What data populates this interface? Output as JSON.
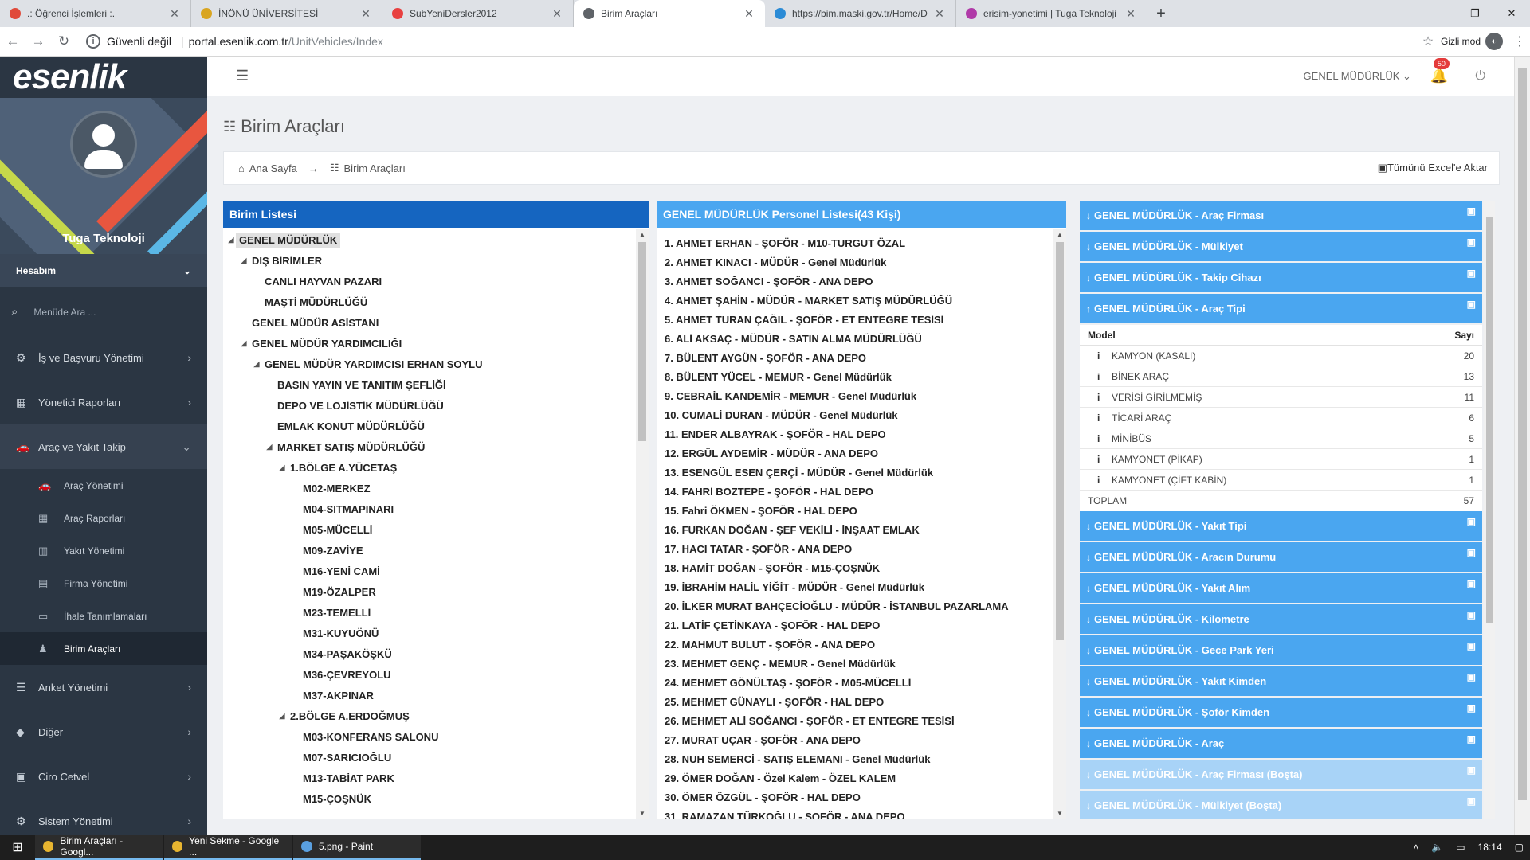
{
  "browser": {
    "tabs": [
      {
        "title": ".: Öğrenci İşlemleri :.",
        "color": "#e04a3a",
        "active": false
      },
      {
        "title": "İNÖNÜ ÜNİVERSİTESİ",
        "color": "#d9a520",
        "active": false
      },
      {
        "title": "SubYeniDersler2012",
        "color": "#e84040",
        "active": false
      },
      {
        "title": "Birim Araçları",
        "color": "#5f6368",
        "active": true
      },
      {
        "title": "https://bim.maski.gov.tr/Home/D",
        "color": "#2b8bd6",
        "active": false
      },
      {
        "title": "erisim-yonetimi | Tuga Teknoloji",
        "color": "#b03aa8",
        "active": false
      }
    ],
    "new_tab": "+",
    "window_controls": [
      "—",
      "❐",
      "✕"
    ],
    "security": "Güvenli değil",
    "url_host": "portal.esenlik.com.tr",
    "url_path": "/UnitVehicles/Index",
    "incognito": "Gizli mod"
  },
  "sidebar": {
    "logo": "esenlik",
    "user": "Tuga Teknoloji",
    "account": "Hesabım",
    "search_placeholder": "Menüde Ara ...",
    "menu": [
      {
        "label": "İş ve Başvuru Yönetimi",
        "icon": "gears-icon",
        "glyph": "⚙"
      },
      {
        "label": "Yönetici Raporları",
        "icon": "chart-icon",
        "glyph": "▦"
      },
      {
        "label": "Araç ve Yakıt Takip",
        "icon": "car-icon",
        "glyph": "🚗",
        "open": true
      }
    ],
    "submenu": [
      {
        "label": "Araç Yönetimi",
        "icon": "car-icon",
        "glyph": "🚗"
      },
      {
        "label": "Araç Raporları",
        "icon": "chart-icon",
        "glyph": "▦"
      },
      {
        "label": "Yakıt Yönetimi",
        "icon": "building-icon",
        "glyph": "▥"
      },
      {
        "label": "Firma Yönetimi",
        "icon": "document-icon",
        "glyph": "▤"
      },
      {
        "label": "İhale Tanımlamaları",
        "icon": "card-icon",
        "glyph": "▭"
      },
      {
        "label": "Birim Araçları",
        "icon": "sitemap-icon",
        "glyph": "♟",
        "active": true
      }
    ],
    "menu_after": [
      {
        "label": "Anket Yönetimi",
        "icon": "list-icon",
        "glyph": "☰"
      },
      {
        "label": "Diğer",
        "icon": "tag-icon",
        "glyph": "◆"
      },
      {
        "label": "Ciro Cetvel",
        "icon": "shop-icon",
        "glyph": "▣"
      },
      {
        "label": "Sistem Yönetimi",
        "icon": "gears-icon",
        "glyph": "⚙"
      }
    ]
  },
  "topbar": {
    "unit": "GENEL MÜDÜRLÜK",
    "notifications": "50"
  },
  "page": {
    "title": "Birim Araçları",
    "breadcrumb_home": "Ana Sayfa",
    "breadcrumb_current": "Birim Araçları",
    "excel_export": "Tümünü Excel'e Aktar"
  },
  "unit_list": {
    "header": "Birim Listesi",
    "header_color": "#1565c0",
    "nodes": [
      {
        "label": "GENEL MÜDÜRLÜK",
        "level": 0,
        "toggle": true,
        "selected": true
      },
      {
        "label": "DIŞ BİRİMLER",
        "level": 1,
        "toggle": true
      },
      {
        "label": "CANLI HAYVAN PAZARI",
        "level": 2
      },
      {
        "label": "MAŞTİ MÜDÜRLÜĞÜ",
        "level": 2
      },
      {
        "label": "GENEL MÜDÜR ASİSTANI",
        "level": 1
      },
      {
        "label": "GENEL MÜDÜR YARDIMCILIĞI",
        "level": 1,
        "toggle": true
      },
      {
        "label": "GENEL MÜDÜR YARDIMCISI ERHAN SOYLU",
        "level": 2,
        "toggle": true
      },
      {
        "label": "BASIN YAYIN VE TANITIM ŞEFLİĞİ",
        "level": 3
      },
      {
        "label": "DEPO VE LOJİSTİK MÜDÜRLÜĞÜ",
        "level": 3
      },
      {
        "label": "EMLAK KONUT MÜDÜRLÜĞÜ",
        "level": 3
      },
      {
        "label": "MARKET SATIŞ MÜDÜRLÜĞÜ",
        "level": 3,
        "toggle": true
      },
      {
        "label": "1.BÖLGE A.YÜCETAŞ",
        "level": 4,
        "toggle": true
      },
      {
        "label": "M02-MERKEZ",
        "level": 5
      },
      {
        "label": "M04-SITMAPINARI",
        "level": 5
      },
      {
        "label": "M05-MÜCELLİ",
        "level": 5
      },
      {
        "label": "M09-ZAVİYE",
        "level": 5
      },
      {
        "label": "M16-YENİ CAMİ",
        "level": 5
      },
      {
        "label": "M19-ÖZALPER",
        "level": 5
      },
      {
        "label": "M23-TEMELLİ",
        "level": 5
      },
      {
        "label": "M31-KUYUÖNÜ",
        "level": 5
      },
      {
        "label": "M34-PAŞAKÖŞKÜ",
        "level": 5
      },
      {
        "label": "M36-ÇEVREYOLU",
        "level": 5
      },
      {
        "label": "M37-AKPINAR",
        "level": 5
      },
      {
        "label": "2.BÖLGE A.ERDOĞMUŞ",
        "level": 4,
        "toggle": true
      },
      {
        "label": "M03-KONFERANS SALONU",
        "level": 5
      },
      {
        "label": "M07-SARICIOĞLU",
        "level": 5
      },
      {
        "label": "M13-TABİAT PARK",
        "level": 5
      },
      {
        "label": "M15-ÇOŞNÜK",
        "level": 5
      }
    ]
  },
  "personnel": {
    "header": "GENEL MÜDÜRLÜK Personel Listesi(43 Kişi)",
    "header_color": "#4aa6f0",
    "rows": [
      "1. AHMET ERHAN - ŞOFÖR - M10-TURGUT ÖZAL",
      "2. AHMET KINACI - MÜDÜR - Genel Müdürlük",
      "3. AHMET SOĞANCI - ŞOFÖR - ANA DEPO",
      "4. AHMET ŞAHİN - MÜDÜR - MARKET SATIŞ MÜDÜRLÜĞÜ",
      "5. AHMET TURAN ÇAĞIL - ŞOFÖR - ET ENTEGRE TESİSİ",
      "6. ALİ AKSAÇ - MÜDÜR - SATIN ALMA MÜDÜRLÜĞÜ",
      "7. BÜLENT AYGÜN - ŞOFÖR - ANA DEPO",
      "8. BÜLENT YÜCEL - MEMUR - Genel Müdürlük",
      "9. CEBRAİL KANDEMİR - MEMUR - Genel Müdürlük",
      "10. CUMALİ DURAN - MÜDÜR - Genel Müdürlük",
      "11. ENDER ALBAYRAK - ŞOFÖR - HAL DEPO",
      "12. ERGÜL AYDEMİR - MÜDÜR - ANA DEPO",
      "13. ESENGÜL ESEN ÇERÇİ - MÜDÜR - Genel Müdürlük",
      "14. FAHRİ BOZTEPE - ŞOFÖR - HAL DEPO",
      "15. Fahri ÖKMEN - ŞOFÖR - HAL DEPO",
      "16. FURKAN DOĞAN - ŞEF VEKİLİ - İNŞAAT EMLAK",
      "17. HACI TATAR - ŞOFÖR - ANA DEPO",
      "18. HAMİT DOĞAN - ŞOFÖR - M15-ÇOŞNÜK",
      "19. İBRAHİM HALİL YİĞİT - MÜDÜR - Genel Müdürlük",
      "20. İLKER MURAT BAHÇECİOĞLU - MÜDÜR - İSTANBUL PAZARLAMA",
      "21. LATİF ÇETİNKAYA - ŞOFÖR - HAL DEPO",
      "22. MAHMUT BULUT - ŞOFÖR - ANA DEPO",
      "23. MEHMET GENÇ - MEMUR - Genel Müdürlük",
      "24. MEHMET GÖNÜLTAŞ - ŞOFÖR - M05-MÜCELLİ",
      "25. MEHMET GÜNAYLI - ŞOFÖR - HAL DEPO",
      "26. MEHMET ALİ SOĞANCI - ŞOFÖR - ET ENTEGRE TESİSİ",
      "27. MURAT UÇAR - ŞOFÖR - ANA DEPO",
      "28. NUH SEMERCİ - SATIŞ ELEMANI - Genel Müdürlük",
      "29. ÖMER DOĞAN - Özel Kalem - ÖZEL KALEM",
      "30. ÖMER ÖZGÜL - ŞOFÖR - HAL DEPO",
      "31. RAMAZAN TÜRKOĞLU - ŞOFÖR - ANA DEPO"
    ]
  },
  "accordions_top": [
    {
      "title": "GENEL MÜDÜRLÜK - Araç Firması",
      "expanded": false
    },
    {
      "title": "GENEL MÜDÜRLÜK - Mülkiyet",
      "expanded": false
    },
    {
      "title": "GENEL MÜDÜRLÜK - Takip Cihazı",
      "expanded": false
    },
    {
      "title": "GENEL MÜDÜRLÜK - Araç Tipi",
      "expanded": true
    }
  ],
  "vehicle_type_table": {
    "col_model": "Model",
    "col_count": "Sayı",
    "info_glyph": "i",
    "rows": [
      {
        "model": "KAMYON (KASALI)",
        "count": "20"
      },
      {
        "model": "BİNEK ARAÇ",
        "count": "13"
      },
      {
        "model": "VERİSİ GİRİLMEMİŞ",
        "count": "11"
      },
      {
        "model": "TİCARİ ARAÇ",
        "count": "6"
      },
      {
        "model": "MİNİBÜS",
        "count": "5"
      },
      {
        "model": "KAMYONET (PİKAP)",
        "count": "1"
      },
      {
        "model": "KAMYONET (ÇİFT KABİN)",
        "count": "1"
      }
    ],
    "total_label": "TOPLAM",
    "total": "57"
  },
  "accordions_bottom": [
    {
      "title": "GENEL MÜDÜRLÜK - Yakıt Tipi",
      "light": false
    },
    {
      "title": "GENEL MÜDÜRLÜK - Aracın Durumu",
      "light": false
    },
    {
      "title": "GENEL MÜDÜRLÜK - Yakıt Alım",
      "light": false
    },
    {
      "title": "GENEL MÜDÜRLÜK - Kilometre",
      "light": false
    },
    {
      "title": "GENEL MÜDÜRLÜK - Gece Park Yeri",
      "light": false
    },
    {
      "title": "GENEL MÜDÜRLÜK - Yakıt Kimden",
      "light": false
    },
    {
      "title": "GENEL MÜDÜRLÜK - Şoför Kimden",
      "light": false
    },
    {
      "title": "GENEL MÜDÜRLÜK - Araç",
      "light": false
    },
    {
      "title": "GENEL MÜDÜRLÜK - Araç Firması (Boşta)",
      "light": true
    },
    {
      "title": "GENEL MÜDÜRLÜK - Mülkiyet (Boşta)",
      "light": true
    }
  ],
  "taskbar": {
    "items": [
      {
        "label": "Birim Araçları - Googl...",
        "color": "#e8b530"
      },
      {
        "label": "Yeni Sekme - Google ...",
        "color": "#e8b530"
      },
      {
        "label": "5.png - Paint",
        "color": "#5aa0e0"
      }
    ],
    "time": "18:14"
  }
}
